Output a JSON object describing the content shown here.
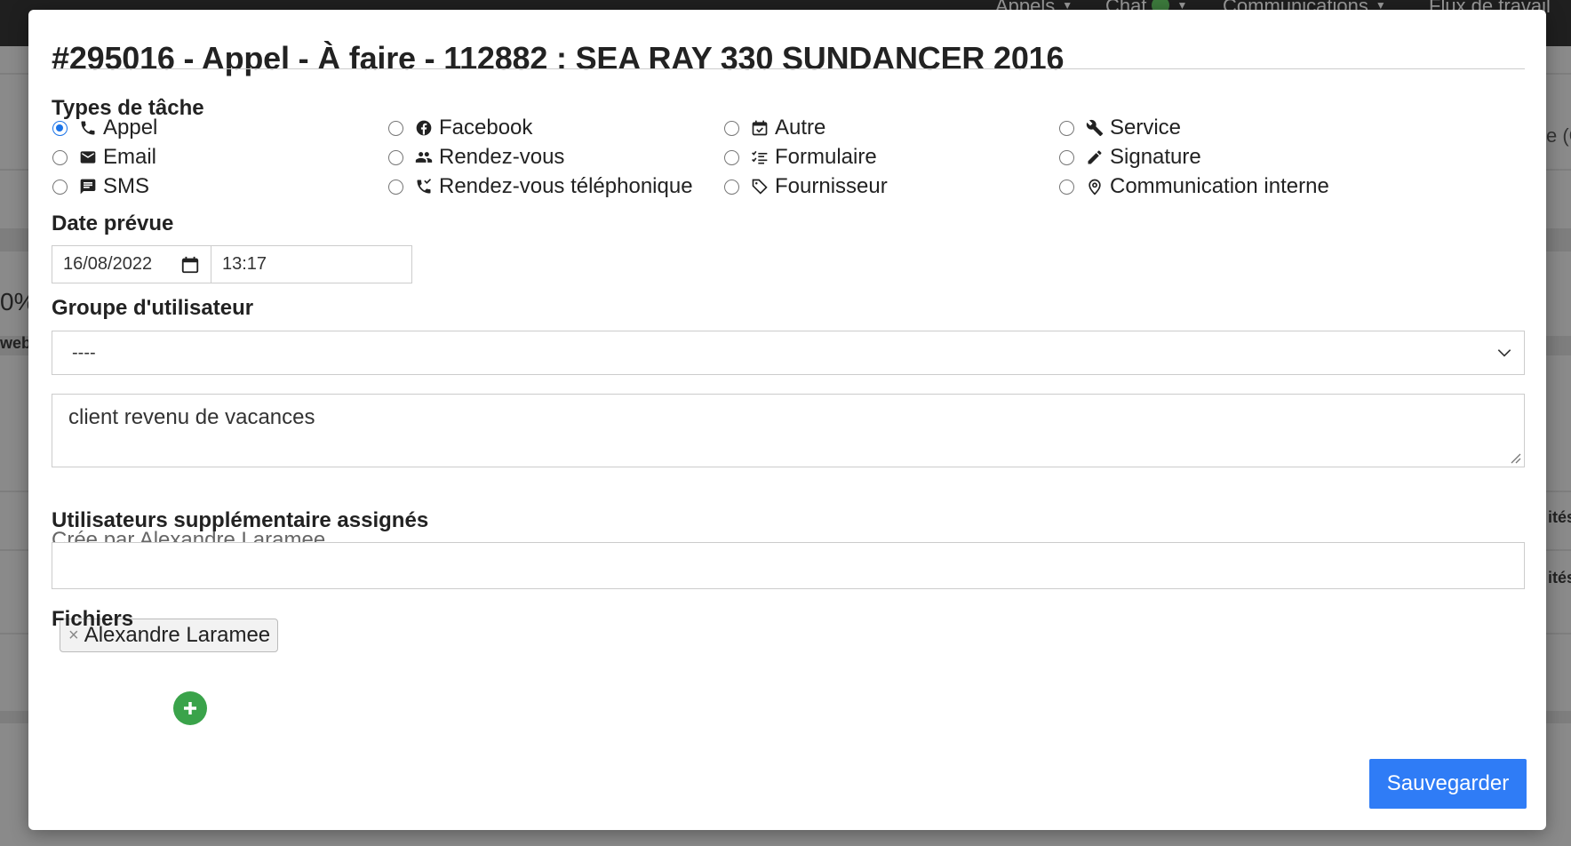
{
  "background": {
    "nav_items": [
      "Appels",
      "Chat",
      "Communications",
      "Flux de travail"
    ],
    "fragments": [
      "0%",
      "web",
      "e (C",
      "ités",
      "ités"
    ]
  },
  "modal": {
    "title": "#295016 - Appel - À faire - 112882 : SEA RAY 330 SUNDANCER 2016",
    "task_types": {
      "label": "Types de tâche",
      "selected": "Appel",
      "options": [
        {
          "label": "Appel",
          "icon": "phone-icon"
        },
        {
          "label": "Email",
          "icon": "envelope-icon"
        },
        {
          "label": "SMS",
          "icon": "message-icon"
        },
        {
          "label": "Facebook",
          "icon": "facebook-icon"
        },
        {
          "label": "Rendez-vous",
          "icon": "people-icon"
        },
        {
          "label": "Rendez-vous téléphonique",
          "icon": "phone-callback-icon"
        },
        {
          "label": "Autre",
          "icon": "calendar-check-icon"
        },
        {
          "label": "Formulaire",
          "icon": "checklist-icon"
        },
        {
          "label": "Fournisseur",
          "icon": "tag-icon"
        },
        {
          "label": "Service",
          "icon": "wrench-icon"
        },
        {
          "label": "Signature",
          "icon": "pen-icon"
        },
        {
          "label": "Communication interne",
          "icon": "map-pin-icon"
        }
      ]
    },
    "date": {
      "label": "Date prévue",
      "date_value": "16/08/2022",
      "time_value": "13:17"
    },
    "user_group": {
      "label": "Groupe d'utilisateur",
      "selected": "----"
    },
    "note": {
      "value": "client revenu de vacances"
    },
    "created_by": "Crée par Alexandre Laramee",
    "assigned_users": {
      "label": "Utilisateurs supplémentaire assignés",
      "tags": [
        "Alexandre Laramee"
      ],
      "remove_symbol": "×"
    },
    "files": {
      "label": "Fichiers",
      "add_symbol": "+"
    },
    "save_label": "Sauvegarder"
  },
  "colors": {
    "accent": "#2f7cf6",
    "radio_checked": "#1a73e8",
    "add_button": "#3aa34a"
  }
}
